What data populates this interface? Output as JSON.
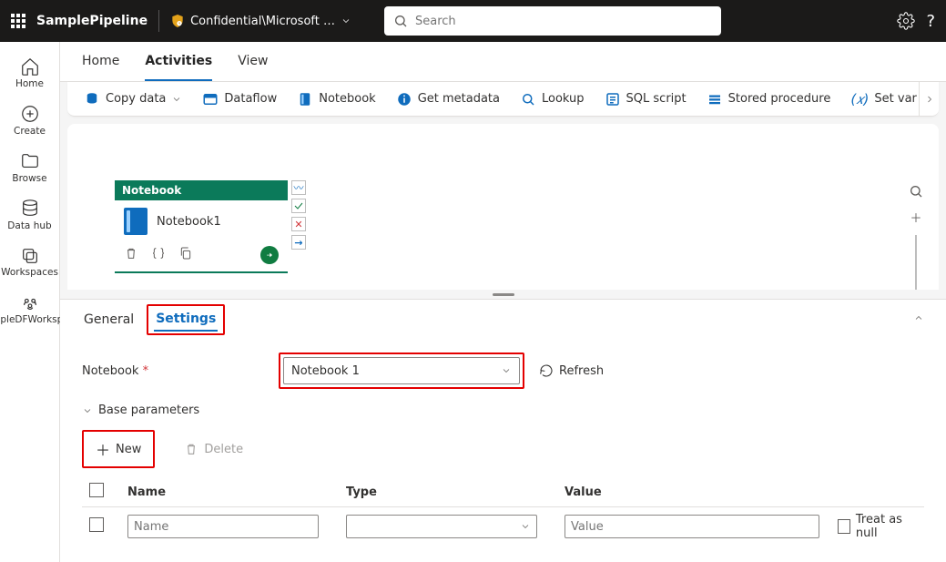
{
  "topbar": {
    "title": "SamplePipeline",
    "workspace": "Confidential\\Microsoft …",
    "search_placeholder": "Search"
  },
  "rail": {
    "items": [
      {
        "label": "Home"
      },
      {
        "label": "Create"
      },
      {
        "label": "Browse"
      },
      {
        "label": "Data hub"
      },
      {
        "label": "Workspaces"
      },
      {
        "label": "SampleDFWorkspace"
      }
    ]
  },
  "page_tabs": [
    "Home",
    "Activities",
    "View"
  ],
  "active_page_tab": "Activities",
  "ribbon": [
    {
      "label": "Copy data",
      "has_dropdown": true
    },
    {
      "label": "Dataflow"
    },
    {
      "label": "Notebook"
    },
    {
      "label": "Get metadata"
    },
    {
      "label": "Lookup"
    },
    {
      "label": "SQL script"
    },
    {
      "label": "Stored procedure"
    },
    {
      "label": "Set var"
    }
  ],
  "canvas": {
    "node": {
      "type_label": "Notebook",
      "name": "Notebook1"
    }
  },
  "panel": {
    "tabs": [
      "General",
      "Settings"
    ],
    "active_tab": "Settings",
    "notebook_label": "Notebook",
    "notebook_value": "Notebook 1",
    "refresh": "Refresh",
    "base_params_label": "Base parameters",
    "new_label": "New",
    "delete_label": "Delete",
    "columns": {
      "name": "Name",
      "type": "Type",
      "value": "Value"
    },
    "row": {
      "name_placeholder": "Name",
      "value_placeholder": "Value",
      "treat_as_null": "Treat as null"
    }
  },
  "highlight_color": "#e40000"
}
